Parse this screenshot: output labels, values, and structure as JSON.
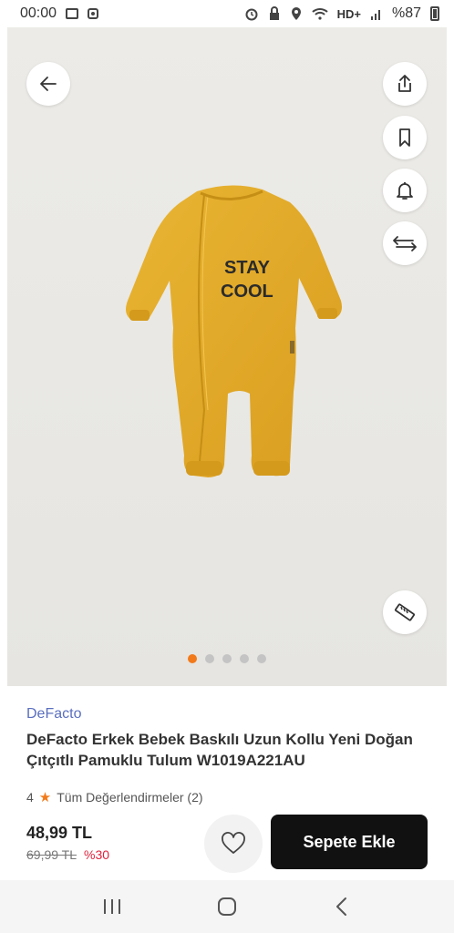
{
  "status_bar": {
    "time": "00:00",
    "network": "HD+",
    "battery": "%87"
  },
  "gallery": {
    "image_count": 5,
    "active_index": 0,
    "print_text_top": "STAY",
    "print_text_bottom": "COOL"
  },
  "product": {
    "brand": "DeFacto",
    "title": "DeFacto Erkek Bebek Baskılı Uzun Kollu Yeni Doğan Çıtçıtlı Pamuklu Tulum W1019A221AU",
    "rating": "4",
    "reviews_label": "Tüm Değerlendirmeler (2)"
  },
  "pricing": {
    "price": "48,99 TL",
    "old_price": "69,99 TL",
    "discount": "%30",
    "add_to_cart_label": "Sepete Ekle"
  },
  "colors": {
    "accent": "#f27a1a",
    "brand_link": "#5a6fbf",
    "discount": "#e0213b",
    "cart_button": "#111111",
    "product_yellow": "#e2aa27"
  }
}
